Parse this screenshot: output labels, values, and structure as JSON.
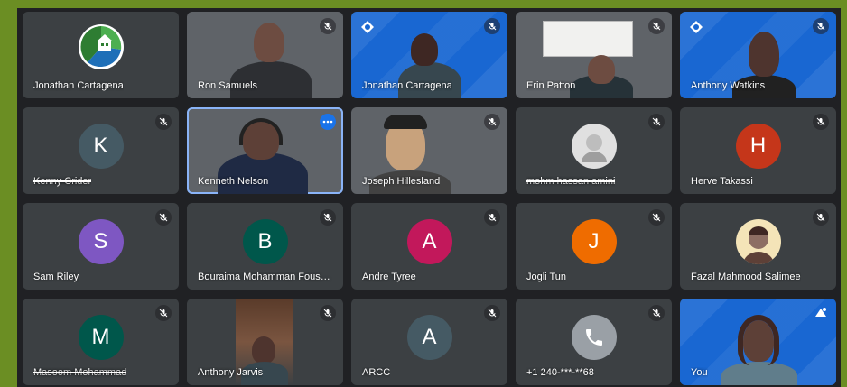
{
  "colors": {
    "page_bg": "#6b8e23",
    "meeting_bg": "#202124",
    "tile_bg": "#3c4043",
    "accent_blue": "#1967d2",
    "active_outline": "#8ab4f8"
  },
  "participants": [
    {
      "name": "Jonathan Cartagena",
      "kind": "logo",
      "muted": false
    },
    {
      "name": "Ron Samuels",
      "kind": "video",
      "muted": true
    },
    {
      "name": "Jonathan Cartagena",
      "kind": "video-blue",
      "muted": true
    },
    {
      "name": "Erin Patton",
      "kind": "video",
      "muted": true
    },
    {
      "name": "Anthony Watkins",
      "kind": "video-blue",
      "muted": true
    },
    {
      "name": "Kenny Crider",
      "kind": "avatar",
      "initial": "K",
      "avatar_color": "#455a64",
      "muted": true,
      "struck": true
    },
    {
      "name": "Kenneth Nelson",
      "kind": "video",
      "muted": false,
      "active": true
    },
    {
      "name": "Joseph Hillesland",
      "kind": "video",
      "muted": true
    },
    {
      "name": "mohm hassan amini",
      "kind": "photo",
      "muted": true,
      "struck": true
    },
    {
      "name": "Herve Takassi",
      "kind": "avatar",
      "initial": "H",
      "avatar_color": "#c5361a",
      "muted": true
    },
    {
      "name": "Sam Riley",
      "kind": "avatar",
      "initial": "S",
      "avatar_color": "#7e57c2",
      "muted": true
    },
    {
      "name": "Bouraima Mohamman Fousse...",
      "kind": "avatar",
      "initial": "B",
      "avatar_color": "#00574b",
      "muted": true
    },
    {
      "name": "Andre Tyree",
      "kind": "avatar",
      "initial": "A",
      "avatar_color": "#c2185b",
      "muted": true
    },
    {
      "name": "Jogli Tun",
      "kind": "avatar",
      "initial": "J",
      "avatar_color": "#ef6c00",
      "muted": true
    },
    {
      "name": "Fazal Mahmood Salimee",
      "kind": "photo",
      "muted": true
    },
    {
      "name": "Masoom Mohammad",
      "kind": "avatar",
      "initial": "M",
      "avatar_color": "#00574b",
      "muted": true,
      "struck": true
    },
    {
      "name": "Anthony Jarvis",
      "kind": "video",
      "muted": true
    },
    {
      "name": "ARCC",
      "kind": "avatar",
      "initial": "A",
      "avatar_color": "#455a64",
      "muted": true
    },
    {
      "name": "+1 240-***-**68",
      "kind": "phone",
      "avatar_color": "#9aa0a6",
      "muted": true
    },
    {
      "name": "You",
      "kind": "video-blue",
      "muted": false
    }
  ]
}
